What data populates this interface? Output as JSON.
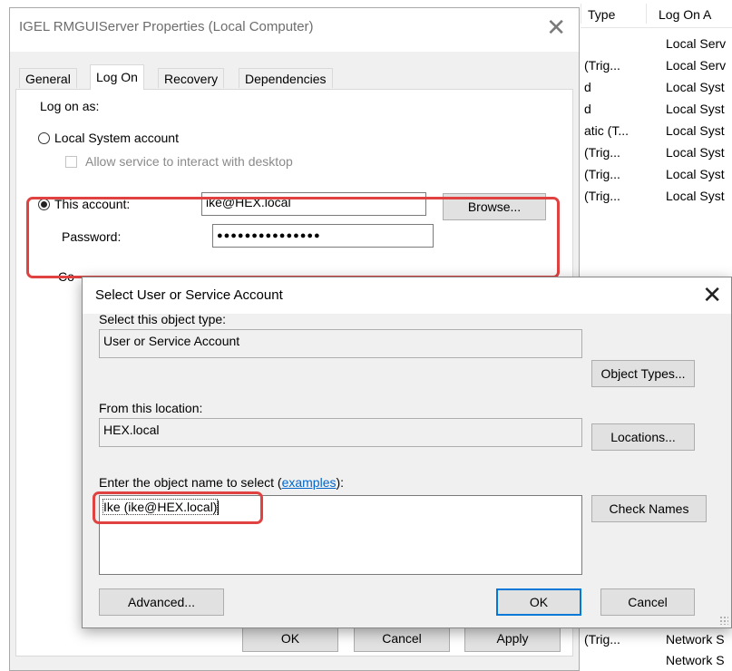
{
  "properties_dialog": {
    "title": "IGEL RMGUIServer Properties (Local Computer)",
    "close_glyph": "✕",
    "tabs": [
      {
        "label": "General",
        "active": false
      },
      {
        "label": "Log On",
        "active": true
      },
      {
        "label": "Recovery",
        "active": false
      },
      {
        "label": "Dependencies",
        "active": false
      }
    ],
    "logon_as_label": "Log on as:",
    "local_system_label": "Local System account",
    "local_system_selected": false,
    "interact_desktop_label": "Allow service to interact with desktop",
    "interact_desktop_checked": false,
    "this_account_label": "This account:",
    "this_account_selected": true,
    "account_value": "ike@HEX.local",
    "browse_label": "Browse...",
    "password_label": "Password:",
    "password_value": "●●●●●●●●●●●●●●●",
    "confirm_label_partial": "Co",
    "ok_label": "OK",
    "cancel_label": "Cancel",
    "apply_label": "Apply"
  },
  "select_dialog": {
    "title": "Select User or Service Account",
    "close_glyph": "✕",
    "object_type_label": "Select this object type:",
    "object_type_value": "User or Service Account",
    "object_types_button": "Object Types...",
    "location_label": "From this location:",
    "location_value": "HEX.local",
    "locations_button": "Locations...",
    "enter_name_label_prefix": "Enter the object name to select (",
    "enter_name_link": "examples",
    "enter_name_label_suffix": "):",
    "object_name_value": "Ike (ike@HEX.local)",
    "check_names_button": "Check Names",
    "advanced_button": "Advanced...",
    "ok_button": "OK",
    "cancel_button": "Cancel"
  },
  "services_list": {
    "columns": [
      "Type",
      "Log On A"
    ],
    "rows_top": [
      {
        "c1": "",
        "c2": "Local Serv"
      },
      {
        "c1": "(Trig...",
        "c2": "Local Serv"
      },
      {
        "c1": "d",
        "c2": "Local Syst"
      },
      {
        "c1": "d",
        "c2": "Local Syst"
      },
      {
        "c1": "atic (T...",
        "c2": "Local Syst"
      },
      {
        "c1": "(Trig...",
        "c2": "Local Syst"
      },
      {
        "c1": "(Trig...",
        "c2": "Local Syst"
      },
      {
        "c1": "(Trig...",
        "c2": "Local Syst"
      }
    ],
    "rows_bottom": [
      {
        "c1": "(Trig...",
        "c2": "Network S"
      },
      {
        "c1": "",
        "c2": "Network S"
      }
    ]
  },
  "colors": {
    "highlight": "#e04141",
    "default_button_border": "#0078d7",
    "link": "#0066cc"
  }
}
